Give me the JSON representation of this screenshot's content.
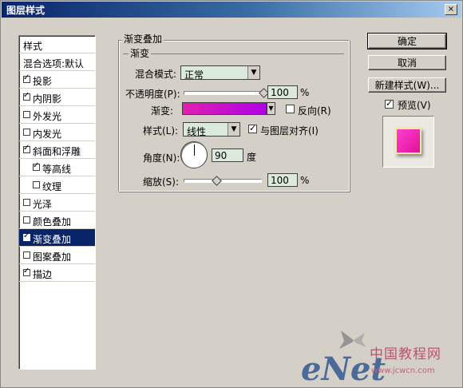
{
  "window": {
    "title": "图层样式",
    "close_glyph": "×"
  },
  "left_panel": {
    "items": [
      {
        "label": "样式",
        "checkbox": false,
        "checked": false,
        "selected": false
      },
      {
        "label": "混合选项:默认",
        "checkbox": false,
        "checked": false,
        "selected": false
      },
      {
        "label": "投影",
        "checkbox": true,
        "checked": true,
        "selected": false
      },
      {
        "label": "内阴影",
        "checkbox": true,
        "checked": true,
        "selected": false
      },
      {
        "label": "外发光",
        "checkbox": true,
        "checked": false,
        "selected": false
      },
      {
        "label": "内发光",
        "checkbox": true,
        "checked": false,
        "selected": false
      },
      {
        "label": "斜面和浮雕",
        "checkbox": true,
        "checked": true,
        "selected": false
      },
      {
        "label": "等高线",
        "checkbox": true,
        "checked": true,
        "selected": false,
        "sub": true
      },
      {
        "label": "纹理",
        "checkbox": true,
        "checked": false,
        "selected": false,
        "sub": true
      },
      {
        "label": "光泽",
        "checkbox": true,
        "checked": false,
        "selected": false
      },
      {
        "label": "颜色叠加",
        "checkbox": true,
        "checked": false,
        "selected": false
      },
      {
        "label": "渐变叠加",
        "checkbox": true,
        "checked": true,
        "selected": true
      },
      {
        "label": "图案叠加",
        "checkbox": true,
        "checked": false,
        "selected": false
      },
      {
        "label": "描边",
        "checkbox": true,
        "checked": true,
        "selected": false
      }
    ]
  },
  "gradient_overlay": {
    "group_title": "渐变叠加",
    "subgroup_title": "渐变",
    "blend_mode_label": "混合模式:",
    "blend_mode_value": "正常",
    "opacity_label": "不透明度(P):",
    "opacity_value": "100",
    "opacity_unit": "%",
    "opacity_level": 1.0,
    "gradient_label": "渐变:",
    "gradient_colors": [
      "#e020b0",
      "#b000e8"
    ],
    "reverse_label": "反向(R)",
    "reverse_checked": false,
    "style_label": "样式(L):",
    "style_value": "线性",
    "align_label": "与图层对齐(I)",
    "align_checked": true,
    "angle_label": "角度(N):",
    "angle_value": "90",
    "angle_unit": "度",
    "scale_label": "缩放(S):",
    "scale_value": "100",
    "scale_unit": "%",
    "scale_level": 0.4
  },
  "buttons": {
    "ok": "确定",
    "cancel": "取消",
    "new_style": "新建样式(W)...",
    "preview_label": "预览(V)",
    "preview_checked": true
  },
  "preview_colors": {
    "fill": "#ff40d0",
    "border": "#ffe8a0"
  },
  "watermark": {
    "brand": "eNet",
    "cn_text": "中国教程网",
    "url": "www.jcwcn.com"
  }
}
